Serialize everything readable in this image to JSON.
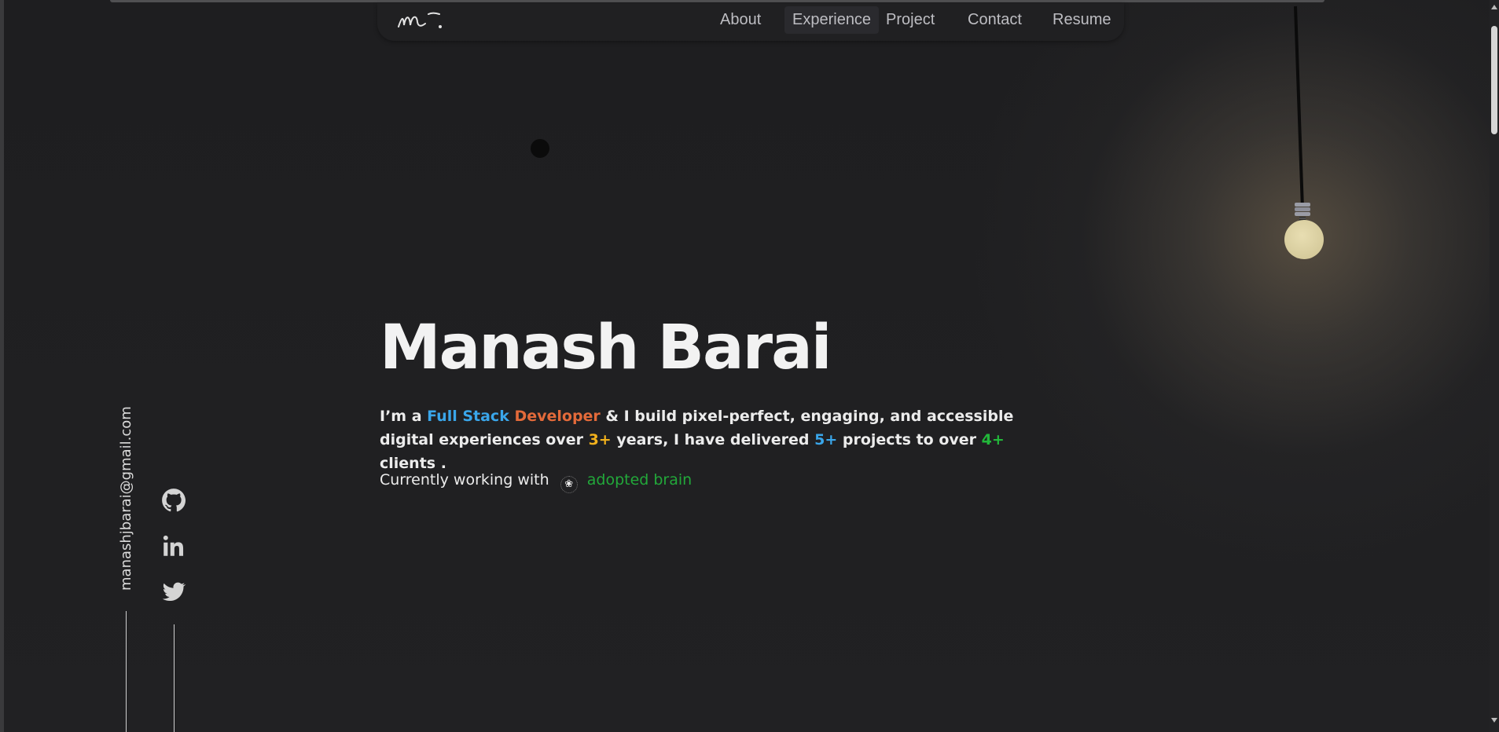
{
  "nav": {
    "logo_text": "m.",
    "items": [
      "About",
      "Experience",
      "Project",
      "Contact",
      "Resume"
    ],
    "active": "Experience"
  },
  "hero": {
    "name": "Manash Barai",
    "intro": {
      "p1": "I’m a ",
      "full_stack": "Full Stack",
      "developer": "Developer",
      "p2": " & I build pixel-perfect, engaging, and accessible digital experiences over ",
      "years": "3+",
      "p3": " years, I have delivered ",
      "projects": "5+",
      "p4": " projects to over ",
      "clients": "4+",
      "p5": " clients ."
    },
    "working_label": "Currently working with",
    "company_icon": "brain-icon",
    "company_name": "adopted brain"
  },
  "sidebar": {
    "email": "manashjbarai@gmail.com",
    "socials": [
      "github-icon",
      "linkedin-icon",
      "twitter-icon"
    ]
  },
  "colors": {
    "background": "#202022",
    "accent_blue": "#3aa6ea",
    "accent_orange": "#e36a3a",
    "accent_yellow": "#f2b11c",
    "accent_green": "#22b73a",
    "bulb": "#d6cb9c"
  }
}
